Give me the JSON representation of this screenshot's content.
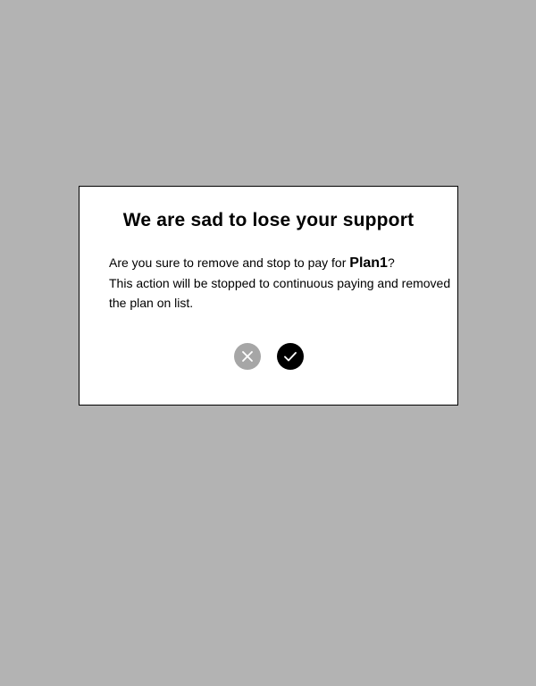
{
  "colors": {
    "backdrop": "#b3b3b3",
    "dialog_background": "#ffffff",
    "cancel_button": "#a6a6a6",
    "confirm_button": "#000000"
  },
  "dialog": {
    "title": "We are sad to lose your support",
    "message_prefix": "Are you sure to remove and stop to pay for ",
    "plan_name": "Plan1",
    "message_suffix": "?",
    "message_detail": "This action will be stopped to continuous paying and removed the plan on list."
  },
  "actions": {
    "cancel_icon": "close-icon",
    "confirm_icon": "check-icon"
  }
}
